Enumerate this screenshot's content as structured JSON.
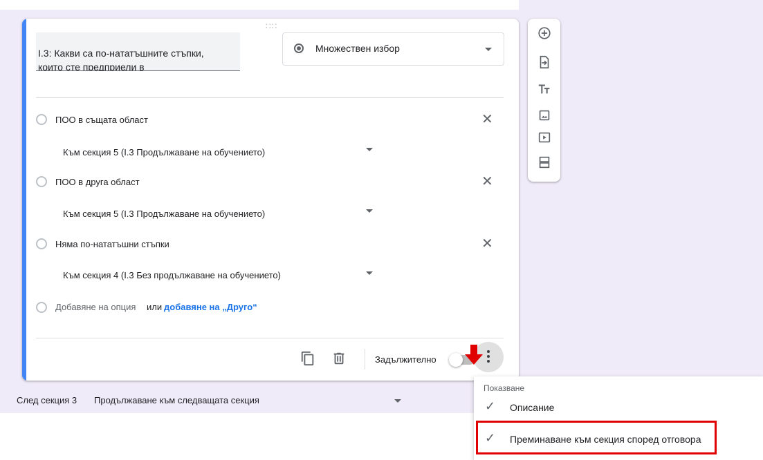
{
  "question": {
    "title": "I.3: Какви са по-нататъшните стъпки, които сте предприели в",
    "type_label": "Множествен избор"
  },
  "options": [
    {
      "label": "ПОО в същата област",
      "goto": "Към секция 5 (I.3 Продължаване на обучението)"
    },
    {
      "label": "ПОО в друга област",
      "goto": "Към секция 5 (I.3 Продължаване на обучението)"
    },
    {
      "label": "Няма по-нататъшни стъпки",
      "goto": "Към секция 4 (I.3 Без продължаване на обучението)"
    }
  ],
  "add_option": {
    "add_label": "Добавяне на опция",
    "or_label": "или",
    "other_label": "добавяне на „Друго“"
  },
  "footer": {
    "required_label": "Задължително",
    "required_on": false
  },
  "after_section": {
    "label": "След секция 3",
    "value": "Продължаване към следващата секция"
  },
  "menu": {
    "header": "Показване",
    "items": [
      {
        "label": "Описание",
        "checked": true
      },
      {
        "label": "Преминаване към секция според отговора",
        "checked": true
      }
    ]
  },
  "toolbar_icons": [
    "add-question-icon",
    "import-questions-icon",
    "add-title-icon",
    "add-image-icon",
    "add-video-icon",
    "add-section-icon"
  ],
  "colors": {
    "accent": "#4285f4",
    "link": "#1a73e8",
    "highlight": "#e00000"
  }
}
